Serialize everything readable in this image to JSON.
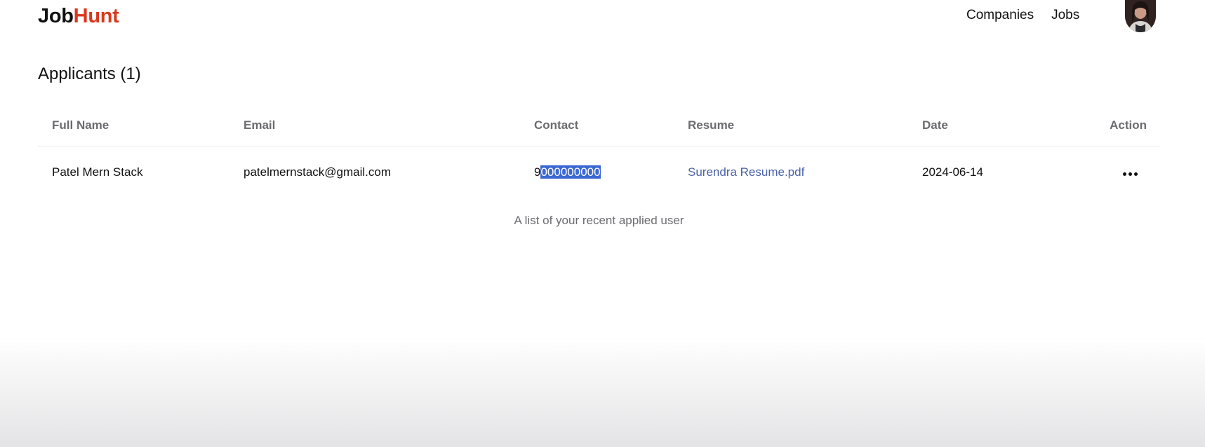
{
  "navbar": {
    "logo_part1": "Job",
    "logo_part2": "Hunt",
    "links": [
      "Companies",
      "Jobs"
    ],
    "avatar_icon": "user-avatar-photo"
  },
  "page": {
    "title": "Applicants (1)"
  },
  "table": {
    "headers": [
      "Full Name",
      "Email",
      "Contact",
      "Resume",
      "Date",
      "Action"
    ],
    "rows": [
      {
        "full_name": "Patel Mern Stack",
        "email": "patelmernstack@gmail.com",
        "contact_first": "9",
        "contact_selected": "000000000",
        "resume": "Surendra Resume.pdf",
        "date": "2024-06-14",
        "action_icon": "more-horizontal-icon"
      }
    ],
    "caption": "A list of your recent applied user"
  },
  "colors": {
    "brand_accent": "#d9381e",
    "link": "#4a63a8",
    "selection": "#3c68d1"
  }
}
